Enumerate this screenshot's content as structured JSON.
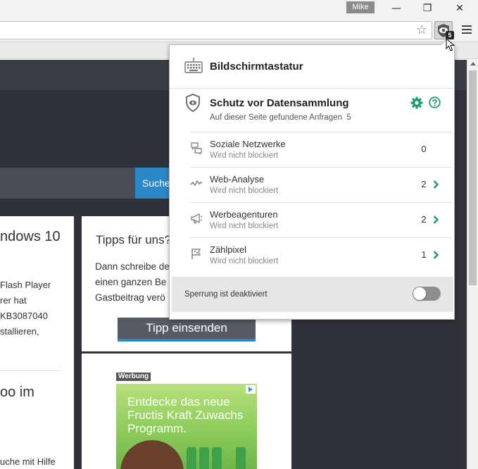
{
  "window": {
    "profile_name": "Mike",
    "minimize_glyph": "—",
    "restore_glyph": "❐",
    "close_glyph": "✕"
  },
  "toolbar": {
    "star_glyph": "☆",
    "extension_badge": "5"
  },
  "page": {
    "search_button_label": "Suche",
    "left_card": {
      "heading1": "ndows 10",
      "lines": [
        "Flash Player",
        "rer hat",
        "KB3087040",
        "stallieren,"
      ],
      "heading2": "oo im",
      "bottom_line": "uche mit Hilfe"
    },
    "mid_card": {
      "heading": "Tipps für uns?",
      "lines": [
        "Dann schreibe de",
        "einen ganzen Be",
        "Gastbeitrag verö"
      ],
      "button_label": "Tipp einsenden"
    },
    "ad": {
      "label": "Werbung",
      "text_lines": [
        "Entdecke das neue",
        "Fructis Kraft Zuwachs",
        "Programm."
      ]
    }
  },
  "popup": {
    "keyboard_title": "Bildschirmtastatur",
    "protection_title": "Schutz vor Datensammlung",
    "requests_label": "Auf dieser Seite gefundene Anfragen",
    "requests_count": "5",
    "categories": [
      {
        "name": "Soziale Netzwerke",
        "status": "Wird nicht blockiert",
        "count": "0",
        "icon": "speech-bubbles-icon"
      },
      {
        "name": "Web-Analyse",
        "status": "Wird nicht blockiert",
        "count": "2",
        "icon": "analytics-wave-icon"
      },
      {
        "name": "Werbeagenturen",
        "status": "Wird nicht blockiert",
        "count": "2",
        "icon": "megaphone-icon"
      },
      {
        "name": "Zählpixel",
        "status": "Wird nicht blockiert",
        "count": "1",
        "icon": "flag-pixel-icon"
      }
    ],
    "footer_label": "Sperrung ist deaktiviert",
    "toggle_on": false
  },
  "colors": {
    "accent_green": "#1f9a6e",
    "page_dark": "#2f3238",
    "search_blue": "#2b87c8"
  }
}
